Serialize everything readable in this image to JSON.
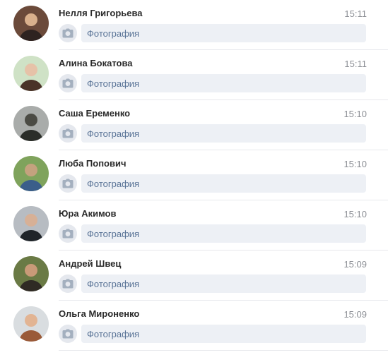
{
  "dialogs": [
    {
      "name": "Нелля Григорьева",
      "time": "15:11",
      "preview": "Фотография",
      "avatar_icon": "user-photo-avatar",
      "avatar_colors": [
        "#6b4a3a",
        "#d9b08c",
        "#2e2320"
      ]
    },
    {
      "name": "Алина Бокатова",
      "time": "15:11",
      "preview": "Фотография",
      "avatar_icon": "user-photo-avatar",
      "avatar_colors": [
        "#cfe2c6",
        "#e6c2a8",
        "#4a3328"
      ]
    },
    {
      "name": "Саша Еременко",
      "time": "15:10",
      "preview": "Фотография",
      "avatar_icon": "user-photo-avatar",
      "avatar_colors": [
        "#a9acaa",
        "#4b4b44",
        "#2b2e29"
      ]
    },
    {
      "name": "Люба Попович",
      "time": "15:10",
      "preview": "Фотография",
      "avatar_icon": "user-photo-avatar",
      "avatar_colors": [
        "#7fa35c",
        "#c4a27e",
        "#3b5e8a"
      ]
    },
    {
      "name": "Юра Акимов",
      "time": "15:10",
      "preview": "Фотография",
      "avatar_icon": "user-photo-avatar",
      "avatar_colors": [
        "#b7bcc2",
        "#d7b096",
        "#1f2429"
      ]
    },
    {
      "name": "Андрей Швец",
      "time": "15:09",
      "preview": "Фотография",
      "avatar_icon": "user-photo-avatar",
      "avatar_colors": [
        "#6a7a45",
        "#c99a78",
        "#2f2a24"
      ]
    },
    {
      "name": "Ольга Мироненко",
      "time": "15:09",
      "preview": "Фотография",
      "avatar_icon": "user-photo-avatar",
      "avatar_colors": [
        "#d9dde0",
        "#e2b493",
        "#9a5a38"
      ]
    }
  ],
  "preview_icon": "camera-icon",
  "colors": {
    "link": "#5a7497",
    "bubble": "#edf0f5",
    "camera_bg": "#e5e8ee",
    "camera_glyph": "#a4b0bf"
  }
}
